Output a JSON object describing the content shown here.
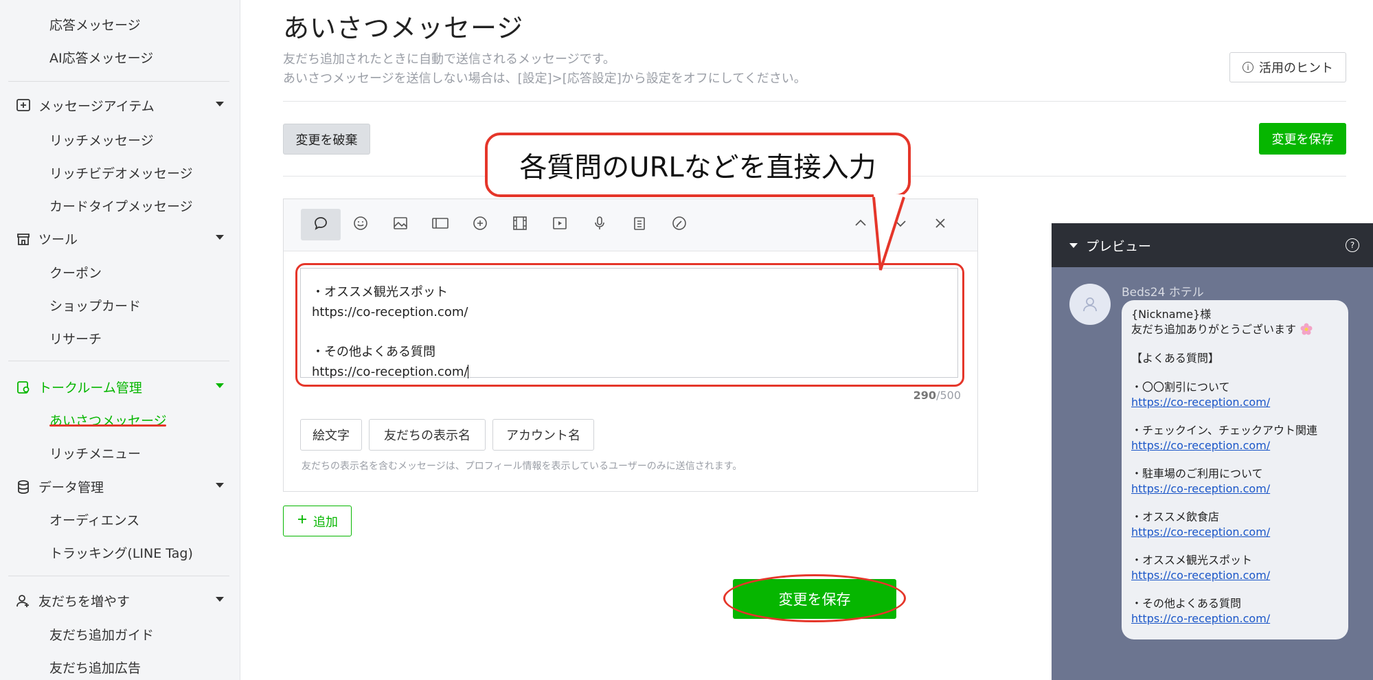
{
  "sidebar": {
    "items": [
      {
        "type": "sub",
        "label": "応答メッセージ"
      },
      {
        "type": "sub",
        "label": "AI応答メッセージ"
      },
      {
        "type": "cat",
        "label": "メッセージアイテム"
      },
      {
        "type": "sub",
        "label": "リッチメッセージ"
      },
      {
        "type": "sub",
        "label": "リッチビデオメッセージ"
      },
      {
        "type": "sub",
        "label": "カードタイプメッセージ"
      },
      {
        "type": "cat",
        "label": "ツール"
      },
      {
        "type": "sub",
        "label": "クーポン"
      },
      {
        "type": "sub",
        "label": "ショップカード"
      },
      {
        "type": "sub",
        "label": "リサーチ"
      },
      {
        "type": "cat",
        "label": "トークルーム管理"
      },
      {
        "type": "sub",
        "label": "あいさつメッセージ"
      },
      {
        "type": "sub",
        "label": "リッチメニュー"
      },
      {
        "type": "cat",
        "label": "データ管理"
      },
      {
        "type": "sub",
        "label": "オーディエンス"
      },
      {
        "type": "sub",
        "label": "トラッキング(LINE Tag)"
      },
      {
        "type": "cat",
        "label": "友だちを増やす"
      },
      {
        "type": "sub",
        "label": "友だち追加ガイド"
      },
      {
        "type": "sub",
        "label": "友だち追加広告"
      }
    ]
  },
  "page": {
    "title": "あいさつメッセージ",
    "desc1": "友だち追加されたときに自動で送信されるメッセージです。",
    "desc2": "あいさつメッセージを送信しない場合は、[設定]>[応答設定]から設定をオフにしてください。",
    "hint_label": "活用のヒント",
    "discard_label": "変更を破棄",
    "save_label": "変更を保存"
  },
  "callout": {
    "text": "各質問のURLなどを直接入力"
  },
  "editor": {
    "lines": [
      "・オススメ観光スポット",
      "https://co-reception.com/",
      "",
      "・その他よくある質問",
      "https://co-reception.com/"
    ],
    "count": "290",
    "max": "/500",
    "chips": [
      "絵文字",
      "友だちの表示名",
      "アカウント名"
    ],
    "note": "友だちの表示名を含むメッセージは、プロフィール情報を表示しているユーザーのみに送信されます。",
    "add_label": "追加"
  },
  "preview": {
    "header": "プレビュー",
    "sender": "Beds24 ホテル",
    "greeting1": "{Nickname}様",
    "greeting2": "友だち追加ありがとうございます",
    "faq_title": "【よくある質問】",
    "faqs": [
      {
        "q": "・〇〇割引について",
        "url": "https://co-reception.com/"
      },
      {
        "q": "・チェックイン、チェックアウト関連",
        "url": "https://co-reception.com/"
      },
      {
        "q": "・駐車場のご利用について",
        "url": "https://co-reception.com/"
      },
      {
        "q": "・オススメ飲食店",
        "url": "https://co-reception.com/"
      },
      {
        "q": "・オススメ観光スポット",
        "url": "https://co-reception.com/"
      },
      {
        "q": "・その他よくある質問",
        "url": "https://co-reception.com/"
      }
    ]
  },
  "colors": {
    "accent": "#06b600",
    "annotation": "#e5362a"
  }
}
